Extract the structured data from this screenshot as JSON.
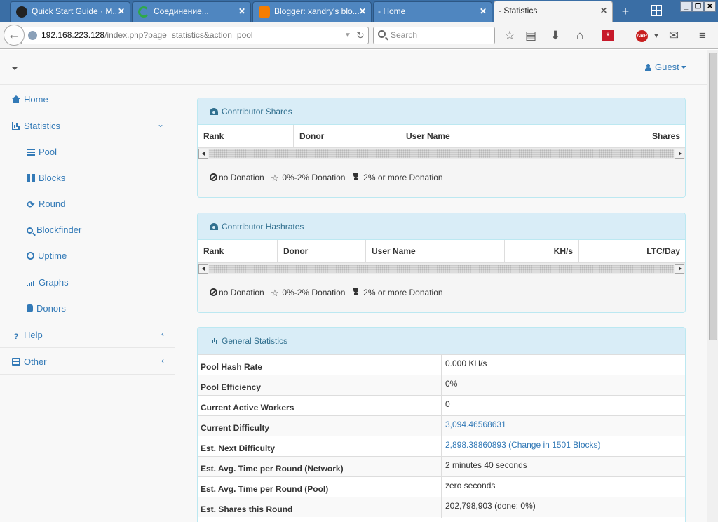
{
  "browser": {
    "tabs": [
      {
        "title": "Quick Start Guide · M...",
        "icon_color": "#222222"
      },
      {
        "title": "Соединение...",
        "icon_color": "#2fa84a"
      },
      {
        "title": "Blogger: xandry's blo...",
        "icon_color": "#f57d00"
      },
      {
        "title": "- Home",
        "icon_color": ""
      },
      {
        "title": "- Statistics",
        "icon_color": ""
      }
    ],
    "url_host": "192.168.223.128",
    "url_path": "/index.php?page=statistics&action=pool",
    "search_placeholder": "Search",
    "newtab_icon": "plus-icon",
    "toolbar_icons": [
      "bookmark-star-icon",
      "reading-list-icon",
      "download-icon",
      "home-icon",
      "lastpass-icon",
      "adblock-plus-icon",
      "gmail-icon",
      "menu-icon"
    ]
  },
  "header": {
    "user_label": "Guest"
  },
  "sidebar": {
    "home": "Home",
    "statistics": "Statistics",
    "sub_items": [
      {
        "label": "Pool",
        "icon": "bars-icon"
      },
      {
        "label": "Blocks",
        "icon": "grid-icon"
      },
      {
        "label": "Round",
        "icon": "refresh-icon"
      },
      {
        "label": "Blockfinder",
        "icon": "search-icon"
      },
      {
        "label": "Uptime",
        "icon": "clock-icon"
      },
      {
        "label": "Graphs",
        "icon": "signal-icon"
      },
      {
        "label": "Donors",
        "icon": "database-icon"
      }
    ],
    "help": "Help",
    "other": "Other"
  },
  "panels": {
    "shares": {
      "title": "Contributor Shares",
      "columns": [
        "Rank",
        "Donor",
        "User Name",
        "Shares"
      ]
    },
    "hashrates": {
      "title": "Contributor Hashrates",
      "columns": [
        "Rank",
        "Donor",
        "User Name",
        "KH/s",
        "LTC/Day"
      ]
    },
    "legend": {
      "none": "no Donation",
      "partial": "0%-2% Donation",
      "full": "2% or more Donation"
    },
    "general": {
      "title": "General Statistics",
      "rows": [
        {
          "label": "Pool Hash Rate",
          "value": "0.000 KH/s",
          "link": false
        },
        {
          "label": "Pool Efficiency",
          "value": "0%",
          "link": false
        },
        {
          "label": "Current Active Workers",
          "value": "0",
          "link": false
        },
        {
          "label": "Current Difficulty",
          "value": "3,094.46568631",
          "link": true
        },
        {
          "label": "Est. Next Difficulty",
          "value": "2,898.38860893 (Change in 1501 Blocks)",
          "link": true
        },
        {
          "label": "Est. Avg. Time per Round (Network)",
          "value": "2 minutes 40 seconds",
          "link": false
        },
        {
          "label": "Est. Avg. Time per Round (Pool)",
          "value": "zero seconds",
          "link": false
        },
        {
          "label": "Est. Shares this Round",
          "value": "202,798,903 (done: 0%)",
          "link": false
        }
      ]
    }
  },
  "colors": {
    "link": "#337ab7",
    "panel_heading_bg": "#d9edf7",
    "panel_heading_text": "#31708f",
    "tabstrip": "#3a6ea5"
  }
}
